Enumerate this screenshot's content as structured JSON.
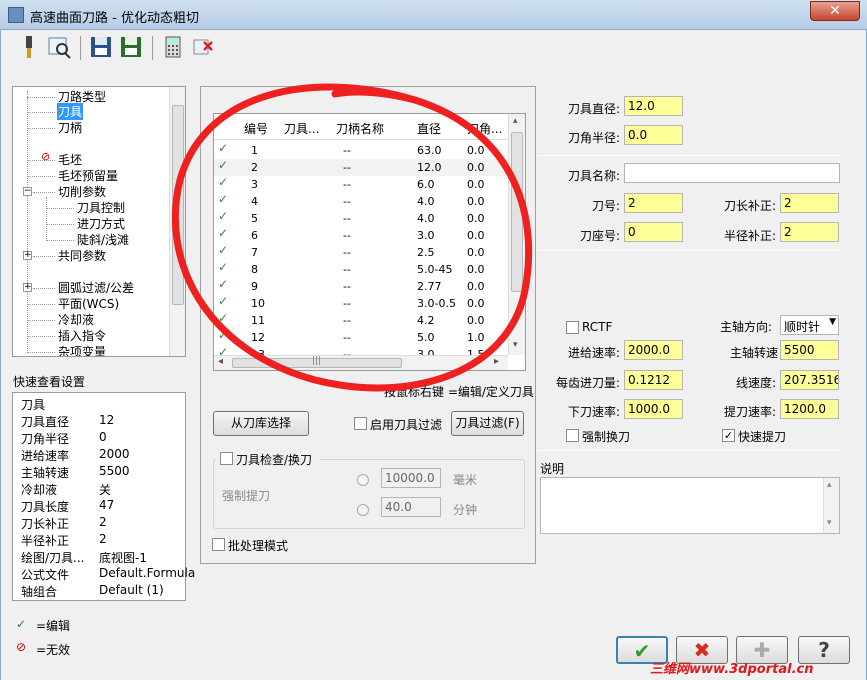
{
  "window": {
    "title": "高速曲面刀路 - 优化动态粗切",
    "close_label": "✕"
  },
  "toolbar": {
    "icons": [
      "tool-icon",
      "preview-icon",
      "save-icon",
      "save-as-icon",
      "calculator-icon",
      "delete-icon"
    ]
  },
  "tree": {
    "items": [
      "刀路类型",
      "刀具",
      "刀柄",
      "毛坯",
      "毛坯预留量",
      "切削参数",
      "刀具控制",
      "进刀方式",
      "陡斜/浅滩",
      "共同参数",
      "圆弧过滤/公差",
      "平面(WCS)",
      "冷却液",
      "插入指令",
      "杂项变量"
    ],
    "expander_minus": "−",
    "expander_plus": "+"
  },
  "quickview": {
    "heading": "快速查看设置",
    "section": "刀具",
    "rows": [
      {
        "k": "刀具直径",
        "v": "12"
      },
      {
        "k": "刀角半径",
        "v": "0"
      },
      {
        "k": "进给速率",
        "v": "2000"
      },
      {
        "k": "主轴转速",
        "v": "5500"
      },
      {
        "k": "冷却液",
        "v": "关"
      },
      {
        "k": "刀具长度",
        "v": "47"
      },
      {
        "k": "刀长补正",
        "v": "2"
      },
      {
        "k": "半径补正",
        "v": "2"
      },
      {
        "k": "绘图/刀具...",
        "v": "底视图-1"
      },
      {
        "k": "公式文件",
        "v": "Default.Formula"
      },
      {
        "k": "轴组合",
        "v": "Default (1)"
      }
    ]
  },
  "legend": {
    "edit_mark": "✓",
    "edit": "=编辑",
    "invalid_mark": "⊘",
    "invalid": "=无效"
  },
  "grid": {
    "headers": [
      "编号",
      "刀具...",
      "刀柄名称",
      "直径",
      "刀角..."
    ],
    "rows": [
      [
        "1",
        "--",
        "63.0",
        "0.0"
      ],
      [
        "2",
        "--",
        "12.0",
        "0.0"
      ],
      [
        "3",
        "--",
        "6.0",
        "0.0"
      ],
      [
        "4",
        "--",
        "4.0",
        "0.0"
      ],
      [
        "5",
        "--",
        "4.0",
        "0.0"
      ],
      [
        "6",
        "--",
        "3.0",
        "0.0"
      ],
      [
        "7",
        "--",
        "2.5",
        "0.0"
      ],
      [
        "8",
        "--",
        "5.0-45",
        "0.0"
      ],
      [
        "9",
        "--",
        "2.77",
        "0.0"
      ],
      [
        "10",
        "--",
        "3.0-0.5",
        "0.0"
      ],
      [
        "11",
        "--",
        "4.2",
        "0.0"
      ],
      [
        "12",
        "--",
        "5.0",
        "1.0"
      ],
      [
        "13",
        "--",
        "3.0",
        "1.5"
      ]
    ],
    "scroll_arrows": {
      "left": "◂",
      "right": "▸",
      "up": "▴",
      "down": "▾",
      "thumb": "|||"
    }
  },
  "hint": "按鼠标右键 =编辑/定义刀具",
  "buttons": {
    "from_library": "从刀库选择",
    "enable_filter": "启用刀具过滤",
    "filter": "刀具过滤(F)"
  },
  "tool_check": {
    "label": "刀具检查/换刀",
    "force_retract": "强制提刀",
    "val1": "10000.0",
    "unit1": "毫米",
    "val2": "40.0",
    "unit2": "分钟"
  },
  "batch_mode": "批处理模式",
  "params": {
    "tool_dia_label": "刀具直径:",
    "tool_dia": "12.0",
    "corner_r_label": "刀角半径:",
    "corner_r": "0.0",
    "tool_name_label": "刀具名称:",
    "tool_name": "",
    "tool_no_label": "刀号:",
    "tool_no": "2",
    "len_comp_label": "刀长补正:",
    "len_comp": "2",
    "holder_no_label": "刀座号:",
    "holder_no": "0",
    "rad_comp_label": "半径补正:",
    "rad_comp": "2",
    "rctf": "RCTF",
    "spindle_dir_label": "主轴方向:",
    "spindle_dir": "顺时针",
    "feed_label": "进给速率:",
    "feed": "2000.0",
    "spindle_label": "主轴转速",
    "spindle": "5500",
    "fpt_label": "每齿进刀量:",
    "fpt": "0.1212",
    "surf_speed_label": "线速度:",
    "surf_speed": "207.3516",
    "plunge_label": "下刀速率:",
    "plunge": "1000.0",
    "retract_label": "提刀速率:",
    "retract": "1200.0",
    "force_change": "强制换刀",
    "rapid_retract": "快速提刀",
    "note_label": "说明"
  },
  "footer": {
    "ok": "✔",
    "cancel": "✖",
    "add": "✚",
    "help": "?"
  },
  "watermark": "三维网www.3dportal.cn"
}
